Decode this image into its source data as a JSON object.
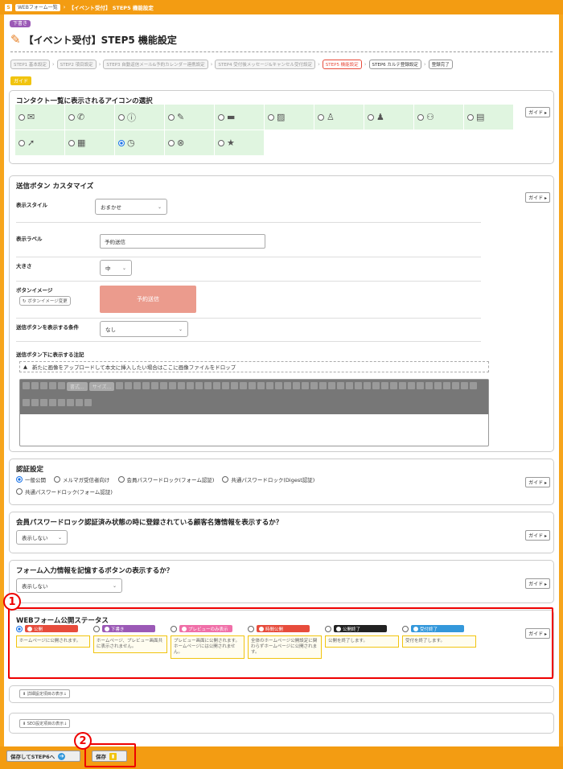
{
  "breadcrumb": {
    "items": [
      "WEBフォーム一覧"
    ],
    "current": "【イベント受付】 STEP5 機能設定"
  },
  "header": {
    "status_badge": "下書き",
    "title": "【イベント受付】STEP5 機能設定"
  },
  "steps": [
    {
      "label": "STEP1 基本設定",
      "state": "done"
    },
    {
      "label": "STEP2 項目設定",
      "state": "done"
    },
    {
      "label": "STEP3 自動返信メール&予約カレンダー連携設定",
      "state": "done"
    },
    {
      "label": "STEP4 受付後メッセージ&キャンセル受付設定",
      "state": "done"
    },
    {
      "label": "STEP5 機能設定",
      "state": "active"
    },
    {
      "label": "STEP6 カルテ登録設定",
      "state": "next"
    },
    {
      "label": "登録完了",
      "state": "next"
    }
  ],
  "guide_label": "ガイド",
  "guide_btn": "ガイド",
  "icons_section": {
    "title": "コンタクト一覧に表示されるアイコンの選択",
    "icons": [
      {
        "name": "mail-icon",
        "glyph": "✉"
      },
      {
        "name": "phone-icon",
        "glyph": "✆"
      },
      {
        "name": "alert-icon",
        "glyph": "ⓘ"
      },
      {
        "name": "pen-icon",
        "glyph": "✎"
      },
      {
        "name": "image-icon",
        "glyph": "▬"
      },
      {
        "name": "note-icon",
        "glyph": "▨"
      },
      {
        "name": "person-icon",
        "glyph": "♙"
      },
      {
        "name": "person-alt-icon",
        "glyph": "♟"
      },
      {
        "name": "people-icon",
        "glyph": "⚇"
      },
      {
        "name": "cards-icon",
        "glyph": "▤"
      },
      {
        "name": "arrow-icon",
        "glyph": "➚"
      },
      {
        "name": "calendar-icon",
        "glyph": "▦"
      },
      {
        "name": "clock-icon",
        "glyph": "◷"
      },
      {
        "name": "cancel-icon",
        "glyph": "⊗"
      },
      {
        "name": "star-icon",
        "glyph": "★"
      }
    ],
    "selected_index": 12
  },
  "submit_section": {
    "title": "送信ボタン カスタマイズ",
    "style_label": "表示スタイル",
    "style_value": "おまかせ",
    "label_label": "表示ラベル",
    "label_value": "予約送信",
    "size_label": "大きさ",
    "size_value": "中",
    "image_label": "ボタンイメージ",
    "image_btn": "ボタンイメージ変更",
    "preview_text": "予約送信",
    "condition_label": "送信ボタンを表示する条件",
    "condition_value": "なし",
    "note_label": "送信ボタン下に表示する注記",
    "dropzone_text": "新たに画像をアップロードして本文に挿入したい場合はここに画像ファイルをドロップ",
    "toolbar_format": "書式...",
    "toolbar_size": "サイズ..."
  },
  "auth_section": {
    "title": "認証設定",
    "options": [
      "一般公開",
      "メルマガ受信者向け",
      "会員パスワードロック(フォーム認証)",
      "共通パスワードロック(Digest認証)",
      "共通パスワードロック(フォーム認証)"
    ],
    "selected_index": 0
  },
  "member_section": {
    "title": "会員パスワードロック認証済み状態の時に登録されている顧客名簿情報を表示するか？",
    "value": "表示しない"
  },
  "remember_section": {
    "title": "フォーム入力情報を記憶するボタンの表示するか？",
    "value": "表示しない"
  },
  "publish_section": {
    "title": "WEBフォーム公開ステータス",
    "selected_index": 0,
    "statuses": [
      {
        "label": "公開",
        "color": "#e74c3c",
        "desc": "ホームページに公開されます。"
      },
      {
        "label": "下書き",
        "color": "#9b59b6",
        "desc": "ホームページ、プレビュー画面共に表示されません。"
      },
      {
        "label": "プレビューのみ表示",
        "color": "#f06fa8",
        "desc": "プレビュー画面に公開されます。ホームページには公開されません。"
      },
      {
        "label": "時間公開",
        "color": "#e74c3c",
        "desc": "全体のホームページ公開設定に関わらずホームページに公開されます。"
      },
      {
        "label": "公開終了",
        "color": "#222222",
        "desc": "公開を終了します。"
      },
      {
        "label": "受付終了",
        "color": "#3498db",
        "desc": "受付を終了します。"
      }
    ]
  },
  "fold_detail": "詳細設定項目の表示↓",
  "fold_seo": "SEO設定項目の表示↓",
  "annotations": {
    "one": "1",
    "two": "2"
  },
  "footer": {
    "save_next": "保存してSTEP6へ",
    "save": "保存"
  }
}
